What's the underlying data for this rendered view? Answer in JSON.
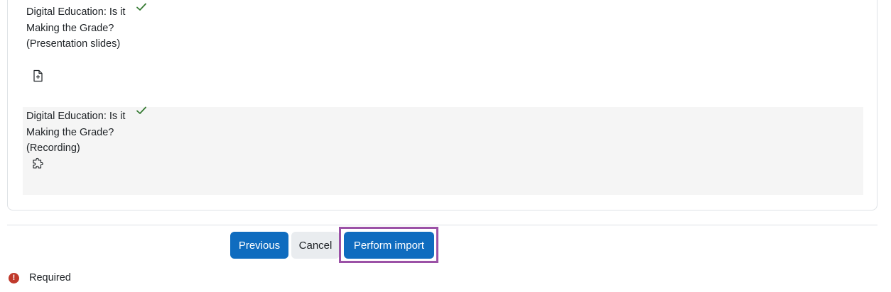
{
  "items": [
    {
      "name": "Digital Education: Is it Making the Grade? (Presentation slides)",
      "icon": "file-plus-icon",
      "included": true
    },
    {
      "name": "Digital Education: Is it Making the Grade? (Recording)",
      "icon": "puzzle-icon",
      "included": true
    }
  ],
  "buttons": {
    "previous": "Previous",
    "cancel": "Cancel",
    "perform_import": "Perform import"
  },
  "required": {
    "icon": "exclamation-icon",
    "label": "Required",
    "icon_glyph": "!"
  },
  "colors": {
    "primary": "#0f6cbf",
    "check": "#357a32",
    "required_icon": "#c0392b",
    "highlight": "#9b51a6",
    "row_stripe": "#f5f5f5"
  }
}
